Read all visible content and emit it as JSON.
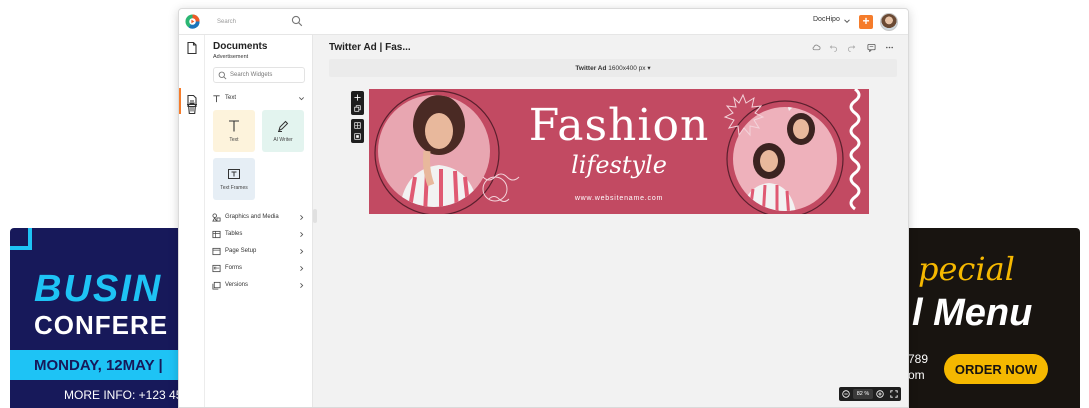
{
  "background_left": {
    "line1": "BUSIN",
    "line2": "CONFERE",
    "line3": "MONDAY, 12MAY  |",
    "line4": "MORE INFO: +123 45",
    "accent": "#1ec3f5",
    "bg": "#17195a"
  },
  "background_right": {
    "line1": "pecial",
    "line2": "l Menu",
    "line3": "789",
    "line4": "om",
    "order_button": "ORDER NOW",
    "accent": "#f5b800",
    "bg": "#181410"
  },
  "topbar": {
    "search_placeholder": "Search",
    "brand": "DocHipo",
    "plus": "+",
    "accent": "#f57c2b"
  },
  "rail": {
    "icons": [
      "document-icon",
      "document-active-icon",
      "trash-icon"
    ]
  },
  "panel": {
    "title": "Documents",
    "subtitle": "Advertisement",
    "search_placeholder": "Search Widgets",
    "text_section": "Text",
    "cards": [
      {
        "label": "Text",
        "icon": "text-t-icon",
        "bg": "#fdf3dc"
      },
      {
        "label": "AI Writer",
        "icon": "ai-pen-icon",
        "bg": "#e3f4ef"
      },
      {
        "label": "Text Frames",
        "icon": "text-frame-icon",
        "bg": "#e6eef5"
      }
    ],
    "sections": [
      {
        "label": "Graphics and Media",
        "icon": "shapes-icon"
      },
      {
        "label": "Tables",
        "icon": "table-icon"
      },
      {
        "label": "Page Setup",
        "icon": "page-setup-icon"
      },
      {
        "label": "Forms",
        "icon": "form-icon"
      },
      {
        "label": "Versions",
        "icon": "versions-icon"
      }
    ]
  },
  "editor": {
    "doc_title": "Twitter Ad | Fas...",
    "size_label_bold": "Twitter Ad",
    "size_label": "1600x400 px",
    "zoom": "82 %"
  },
  "banner": {
    "headline": "Fashion",
    "script": "lifestyle",
    "website": "www.websitename.com",
    "bg": "#c24a62"
  }
}
